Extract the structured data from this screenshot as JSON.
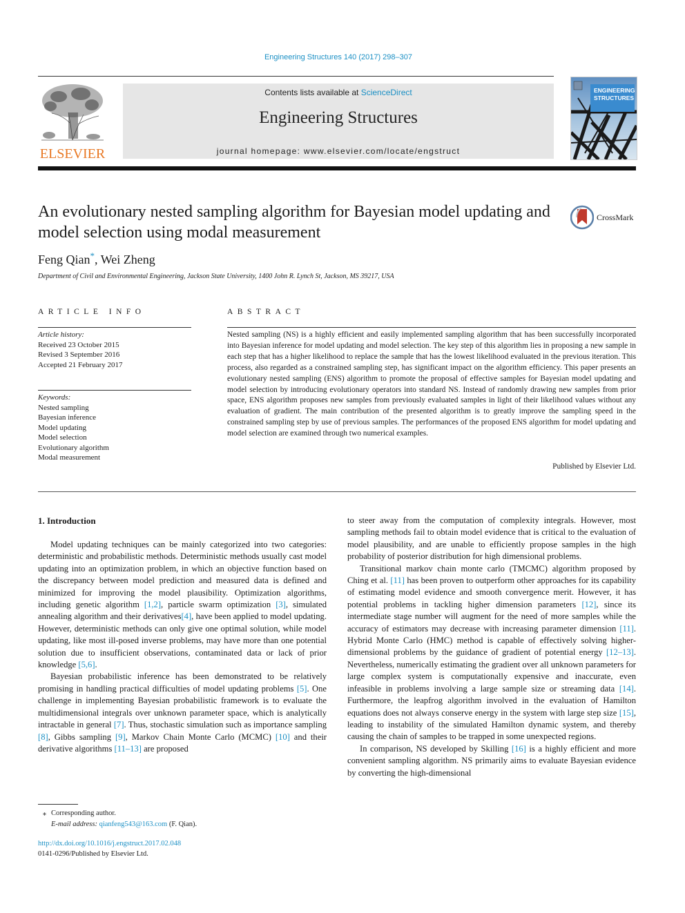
{
  "header": {
    "journal_reference": "Engineering Structures 140 (2017) 298–307",
    "contents_prefix": "Contents lists available at ",
    "contents_link": "ScienceDirect",
    "journal_title": "Engineering Structures",
    "homepage_prefix": "journal homepage: ",
    "homepage_url": "www.elsevier.com/locate/engstruct",
    "publisher_logo_text": "ELSEVIER",
    "cover_title_line1": "Engineering",
    "cover_title_line2": "Structures",
    "accent_color": "#1a8fc4",
    "publisher_color": "#e87722"
  },
  "article": {
    "title": "An evolutionary nested sampling algorithm for Bayesian model updating and model selection using modal measurement",
    "crossmark_label": "CrossMark",
    "authors": [
      {
        "name": "Feng Qian",
        "marker": "*"
      },
      {
        "name": "Wei Zheng",
        "marker": ""
      }
    ],
    "author_separator": ", ",
    "affiliation": "Department of Civil and Environmental Engineering, Jackson State University, 1400 John R. Lynch St, Jackson, MS 39217, USA"
  },
  "article_info": {
    "heading": "ARTICLE INFO",
    "history_label": "Article history:",
    "history": [
      "Received 23 October 2015",
      "Revised 3 September 2016",
      "Accepted 21 February 2017"
    ],
    "keywords_label": "Keywords:",
    "keywords": [
      "Nested sampling",
      "Bayesian inference",
      "Model updating",
      "Model selection",
      "Evolutionary algorithm",
      "Modal measurement"
    ]
  },
  "abstract": {
    "heading": "ABSTRACT",
    "text": "Nested sampling (NS) is a highly efficient and easily implemented sampling algorithm that has been successfully incorporated into Bayesian inference for model updating and model selection. The key step of this algorithm lies in proposing a new sample in each step that has a higher likelihood to replace the sample that has the lowest likelihood evaluated in the previous iteration. This process, also regarded as a constrained sampling step, has significant impact on the algorithm efficiency. This paper presents an evolutionary nested sampling (ENS) algorithm to promote the proposal of effective samples for Bayesian model updating and model selection by introducing evolutionary operators into standard NS. Instead of randomly drawing new samples from prior space, ENS algorithm proposes new samples from previously evaluated samples in light of their likelihood values without any evaluation of gradient. The main contribution of the presented algorithm is to greatly improve the sampling speed in the constrained sampling step by use of previous samples. The performances of the proposed ENS algorithm for model updating and model selection are examined through two numerical examples.",
    "publisher_note": "Published by Elsevier Ltd."
  },
  "body": {
    "section_heading": "1. Introduction",
    "left_paragraphs": [
      [
        {
          "t": "Model updating techniques can be mainly categorized into two categories: deterministic and probabilistic methods. Deterministic methods usually cast model updating into an optimization problem, in which an objective function based on the discrepancy between model prediction and measured data is defined and minimized for improving the model plausibility. Optimization algorithms, including genetic algorithm "
        },
        {
          "c": "[1,2]"
        },
        {
          "t": ", particle swarm optimization "
        },
        {
          "c": "[3]"
        },
        {
          "t": ", simulated annealing algorithm and their derivatives"
        },
        {
          "c": "[4]"
        },
        {
          "t": ", have been applied to model updating. However, deterministic methods can only give one optimal solution, while model updating, like most ill-posed inverse problems, may have more than one potential solution due to insufficient observations, contaminated data or lack of prior knowledge "
        },
        {
          "c": "[5,6]"
        },
        {
          "t": "."
        }
      ],
      [
        {
          "t": "Bayesian probabilistic inference has been demonstrated to be relatively promising in handling practical difficulties of model updating problems "
        },
        {
          "c": "[5]"
        },
        {
          "t": ". One challenge in implementing Bayesian probabilistic framework is to evaluate the multidimensional integrals over unknown parameter space, which is analytically intractable in general "
        },
        {
          "c": "[7]"
        },
        {
          "t": ". Thus, stochastic simulation such as importance sampling "
        },
        {
          "c": "[8]"
        },
        {
          "t": ", Gibbs sampling "
        },
        {
          "c": "[9]"
        },
        {
          "t": ", Markov Chain Monte Carlo (MCMC) "
        },
        {
          "c": "[10]"
        },
        {
          "t": " and their derivative algorithms "
        },
        {
          "c": "[11–13]"
        },
        {
          "t": " are proposed"
        }
      ]
    ],
    "right_paragraphs": [
      [
        {
          "t": "to steer away from the computation of complexity integrals. However, most sampling methods fail to obtain model evidence that is critical to the evaluation of model plausibility, and are unable to efficiently propose samples in the high probability of posterior distribution for high dimensional problems."
        }
      ],
      [
        {
          "t": "Transitional markov chain monte carlo (TMCMC) algorithm proposed by Ching et al. "
        },
        {
          "c": "[11]"
        },
        {
          "t": " has been proven to outperform other approaches for its capability of estimating model evidence and smooth convergence merit. However, it has potential problems in tackling higher dimension parameters "
        },
        {
          "c": "[12]"
        },
        {
          "t": ", since its intermediate stage number will augment for the need of more samples while the accuracy of estimators may decrease with increasing parameter dimension "
        },
        {
          "c": "[11]"
        },
        {
          "t": ". Hybrid Monte Carlo (HMC) method is capable of effectively solving higher-dimensional problems by the guidance of gradient of potential energy "
        },
        {
          "c": "[12–13]"
        },
        {
          "t": ". Nevertheless, numerically estimating the gradient over all unknown parameters for large complex system is computationally expensive and inaccurate, even infeasible in problems involving a large sample size or streaming data "
        },
        {
          "c": "[14]"
        },
        {
          "t": ". Furthermore, the leapfrog algorithm involved in the evaluation of Hamilton equations does not always conserve energy in the system with large step size "
        },
        {
          "c": "[15]"
        },
        {
          "t": ", leading to instability of the simulated Hamilton dynamic system, and thereby causing the chain of samples to be trapped in some unexpected regions."
        }
      ],
      [
        {
          "t": "In comparison, NS developed by Skilling "
        },
        {
          "c": "[16]"
        },
        {
          "t": " is a highly efficient and more convenient sampling algorithm. NS primarily aims to evaluate Bayesian evidence by converting the high-dimensional"
        }
      ]
    ]
  },
  "footnote": {
    "marker": "⁎",
    "corresponding": "Corresponding author.",
    "email_label": "E-mail address: ",
    "email": "qianfeng543@163.com",
    "email_suffix": " (F. Qian)."
  },
  "doi": {
    "url": "http://dx.doi.org/10.1016/j.engstruct.2017.02.048",
    "issn_line": "0141-0296/Published by Elsevier Ltd."
  }
}
